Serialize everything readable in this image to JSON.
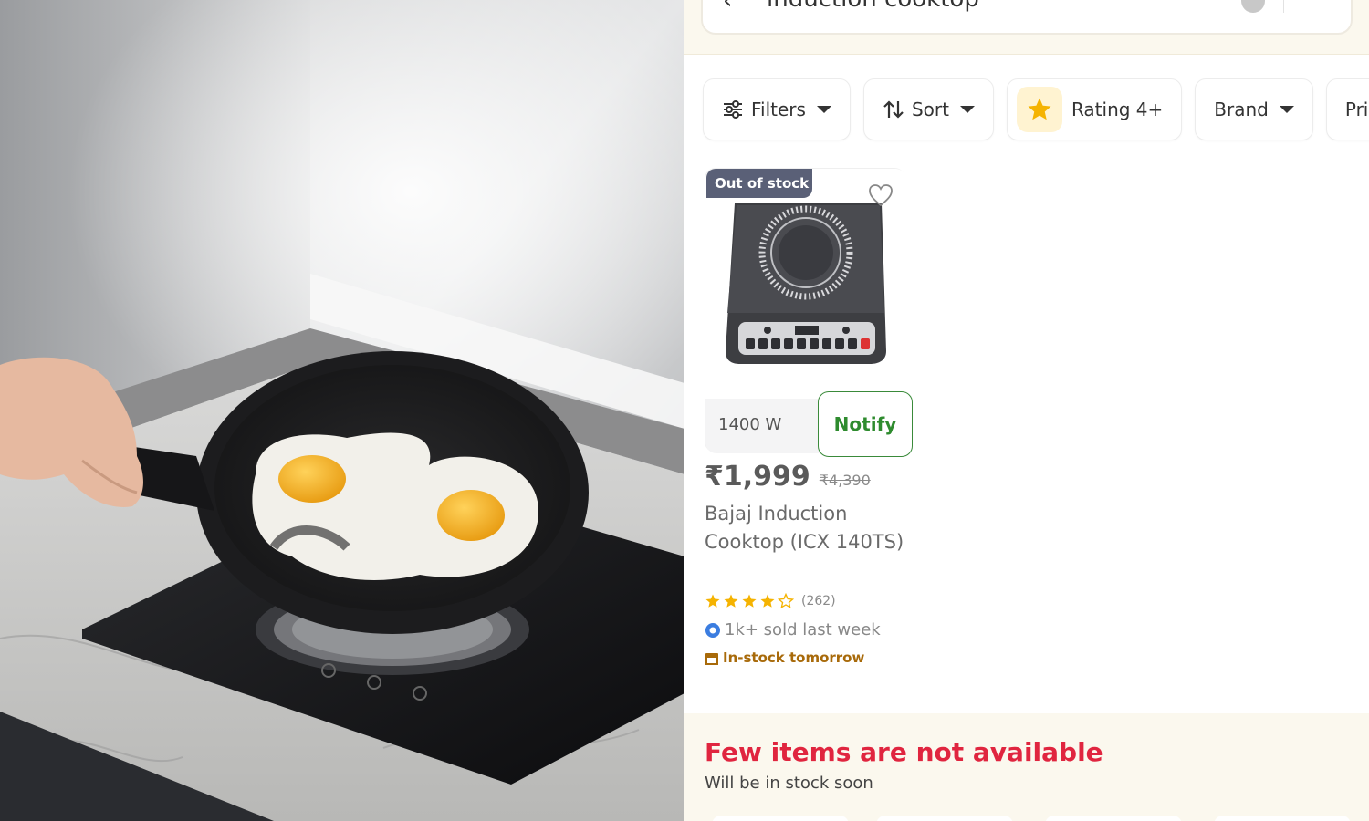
{
  "search": {
    "query": "induction cooktop"
  },
  "filters": [
    {
      "label": "Filters",
      "icon": "sliders-icon"
    },
    {
      "label": "Sort",
      "icon": "sort-arrows-icon"
    },
    {
      "label": "Rating 4+",
      "icon": "star-icon"
    },
    {
      "label": "Brand",
      "icon": ""
    },
    {
      "label": "Pric",
      "icon": ""
    }
  ],
  "product": {
    "badge": "Out of stock",
    "wattage": "1400 W",
    "notify_label": "Notify",
    "price": "₹1,999",
    "mrp": "₹4,390",
    "name": "Bajaj Induction Cooktop (ICX 140TS)",
    "rating": 4,
    "rating_count": "(262)",
    "sold": "1k+ sold last week",
    "stock_note": "In-stock tomorrow"
  },
  "unavailable": {
    "title": "Few items are not available",
    "subtitle": "Will be in stock soon"
  },
  "colors": {
    "accent_red": "#e0253f",
    "notify_green": "#2e8b2e",
    "badge_slate": "#5a6077",
    "stock_amber": "#a86a0a",
    "panel_cream": "#fbf8ee"
  }
}
